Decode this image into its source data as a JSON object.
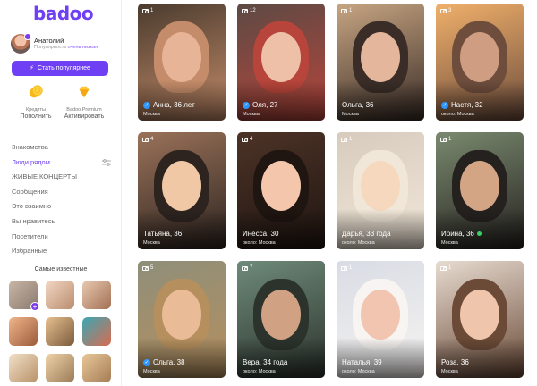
{
  "app": {
    "logo": "badoo"
  },
  "profile": {
    "name": "Анатолий",
    "sub_prefix": "Популярность ",
    "sub_level": "очень низкая"
  },
  "popular_button": "Стать популярнее",
  "perks": [
    {
      "l1": "Кредиты",
      "l2": "Пополнить"
    },
    {
      "l1": "Badoo Premium",
      "l2": "Активировать"
    }
  ],
  "menu": [
    {
      "label": "Знакомства"
    },
    {
      "label": "Люди рядом"
    },
    {
      "label": "ЖИВЫЕ КОНЦЕРТЫ"
    },
    {
      "label": "Сообщения"
    },
    {
      "label": "Это взаимно"
    },
    {
      "label": "Вы нравитесь"
    },
    {
      "label": "Посетители"
    },
    {
      "label": "Избранные"
    }
  ],
  "famous_title": "Самые известные",
  "cards": [
    {
      "count": "1",
      "name": "Анна, 36 лет",
      "city": "Москва",
      "verified": true,
      "online": false
    },
    {
      "count": "12",
      "name": "Оля, 27",
      "city": "Москва",
      "verified": true,
      "online": false
    },
    {
      "count": "1",
      "name": "Ольга, 36",
      "city": "Москва",
      "verified": false,
      "online": false
    },
    {
      "count": "3",
      "name": "Настя, 32",
      "city": "около: Москва",
      "verified": true,
      "online": false
    },
    {
      "count": "4",
      "name": "Татьяна, 36",
      "city": "Москва",
      "verified": false,
      "online": false
    },
    {
      "count": "4",
      "name": "Инесса, 30",
      "city": "около: Москва",
      "verified": false,
      "online": false
    },
    {
      "count": "1",
      "name": "Дарья, 33 года",
      "city": "около: Москва",
      "verified": false,
      "online": false
    },
    {
      "count": "1",
      "name": "Ирина, 36",
      "city": "Москва",
      "verified": false,
      "online": true
    },
    {
      "count": "5",
      "name": "Ольга, 38",
      "city": "Москва",
      "verified": true,
      "online": false
    },
    {
      "count": "7",
      "name": "Вера, 34 года",
      "city": "около: Москва",
      "verified": false,
      "online": false
    },
    {
      "count": "1",
      "name": "Наталья, 39",
      "city": "около: Москва",
      "verified": false,
      "online": false
    },
    {
      "count": "1",
      "name": "Роза, 36",
      "city": "Москва",
      "verified": false,
      "online": false
    }
  ],
  "colors": {
    "brand": "#6e3ff3",
    "verified": "#2f96ff",
    "online": "#38d26b"
  }
}
